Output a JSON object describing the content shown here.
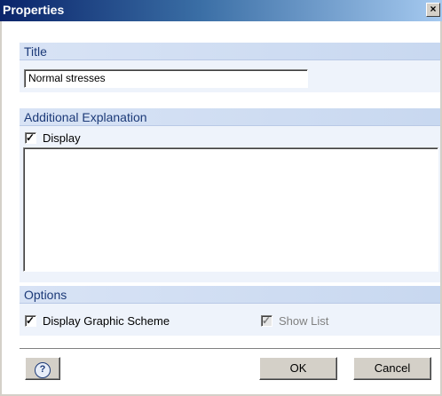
{
  "window": {
    "title": "Properties",
    "close_label": "×"
  },
  "title_section": {
    "header": "Title",
    "value": "Normal stresses"
  },
  "explanation_section": {
    "header": "Additional Explanation",
    "display_checked": true,
    "display_label": "Display",
    "text": ""
  },
  "options_section": {
    "header": "Options",
    "display_scheme_checked": true,
    "display_scheme_label": "Display Graphic Scheme",
    "show_list_checked": true,
    "show_list_disabled": true,
    "show_list_label": "Show List"
  },
  "buttons": {
    "help_icon": "help-icon",
    "ok": "OK",
    "cancel": "Cancel"
  },
  "colors": {
    "title_gradient_start": "#0a246a",
    "section_header": "#c8d8f0",
    "section_text": "#1c3a78"
  }
}
